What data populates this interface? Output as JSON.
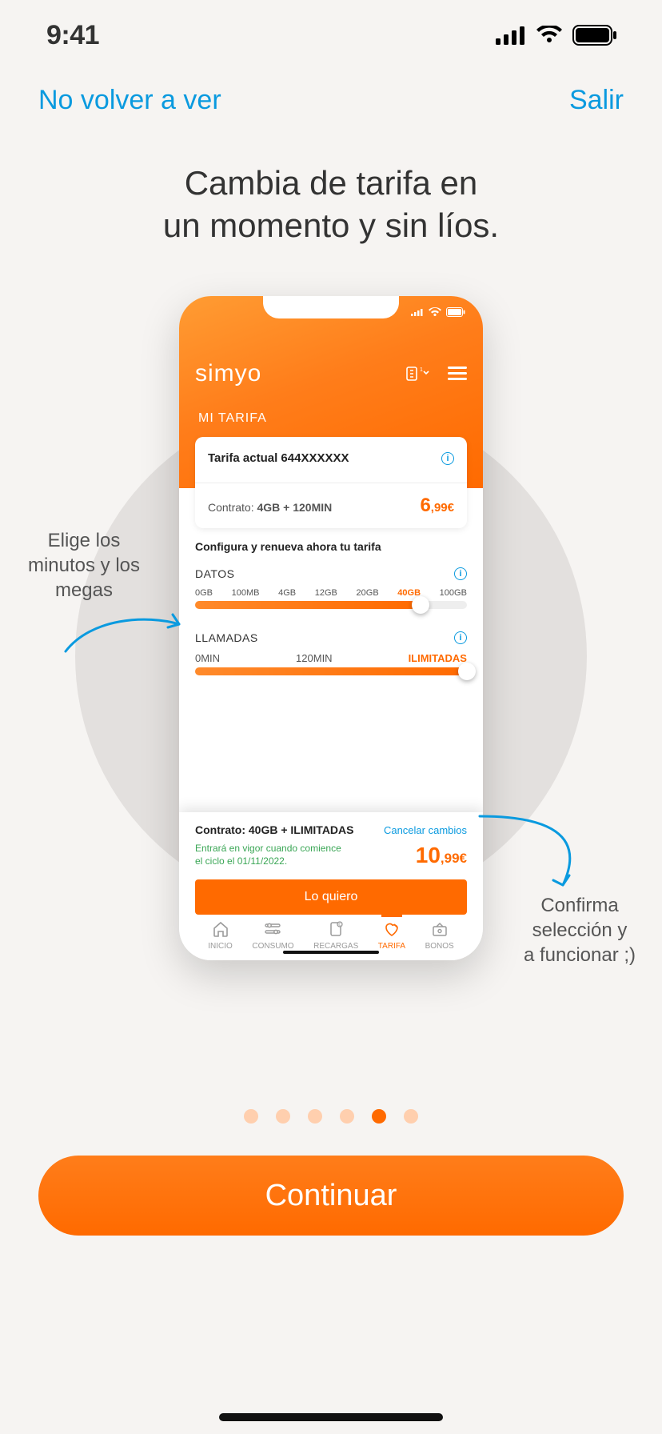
{
  "status": {
    "time": "9:41"
  },
  "header": {
    "dismiss": "No volver a ver",
    "exit": "Salir"
  },
  "title": {
    "line1": "Cambia de tarifa en",
    "line2": "un momento y sin líos."
  },
  "callouts": {
    "left_l1": "Elige los",
    "left_l2": "minutos y los",
    "left_l3": "megas",
    "right_l1": "Confirma",
    "right_l2": "selección y",
    "right_l3": "a funcionar ;)"
  },
  "phone": {
    "brand": "simyo",
    "section": "MI TARIFA",
    "tarifa_label": "Tarifa actual 644XXXXXX",
    "desc_prefix": "Contrato: ",
    "desc_value": "4GB + 120MIN",
    "price_major": "6",
    "price_minor": ",99€",
    "config_head": "Configura y renueva ahora tu tarifa",
    "datos": {
      "label": "DATOS",
      "ticks": [
        "0GB",
        "100MB",
        "4GB",
        "12GB",
        "20GB",
        "40GB",
        "100GB"
      ],
      "active_index": 5,
      "fill_pct": 83
    },
    "llamadas": {
      "label": "LLAMADAS",
      "ticks": [
        "0MIN",
        "120MIN",
        "ILIMITADAS"
      ],
      "active_index": 2,
      "fill_pct": 100
    },
    "summary": {
      "contract_prefix": "Contrato: ",
      "contract_value": "40GB + ILIMITADAS",
      "cancel": "Cancelar cambios",
      "effective": "Entrará en vigor cuando comience el ciclo el 01/11/2022.",
      "price_major": "10",
      "price_minor": ",99€",
      "cta": "Lo quiero"
    },
    "tabs": [
      {
        "label": "INICIO"
      },
      {
        "label": "CONSUMO"
      },
      {
        "label": "RECARGAS"
      },
      {
        "label": "TARIFA"
      },
      {
        "label": "BONOS"
      }
    ],
    "active_tab": 3
  },
  "pagination": {
    "count": 6,
    "active": 4
  },
  "cta": "Continuar"
}
